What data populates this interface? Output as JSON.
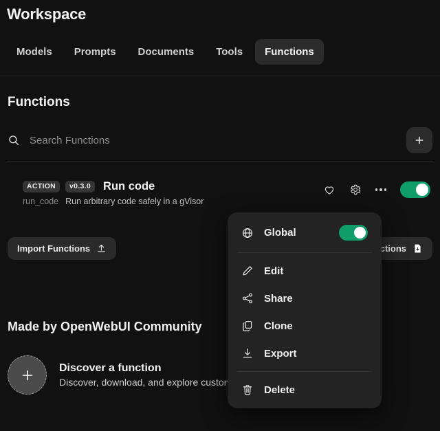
{
  "header": {
    "title": "Workspace",
    "tabs": [
      {
        "label": "Models",
        "active": false
      },
      {
        "label": "Prompts",
        "active": false
      },
      {
        "label": "Documents",
        "active": false
      },
      {
        "label": "Tools",
        "active": false
      },
      {
        "label": "Functions",
        "active": true
      }
    ]
  },
  "page": {
    "title": "Functions"
  },
  "search": {
    "placeholder": "Search Functions",
    "value": "",
    "icon": "search-icon",
    "add_icon": "plus-icon"
  },
  "function_item": {
    "type_badge": "ACTION",
    "version_badge": "v0.3.0",
    "name": "Run code",
    "id": "run_code",
    "description": "Run arbitrary code safely in a gVisor",
    "favorite_icon": "heart-icon",
    "settings_icon": "gear-icon",
    "more_icon": "ellipsis-icon",
    "enabled": true
  },
  "io_buttons": {
    "import_label": "Import Functions",
    "import_icon": "upload-icon",
    "export_label": "Export Functions",
    "export_icon": "document-download-icon"
  },
  "community": {
    "title": "Made by OpenWebUI Community",
    "discover_icon": "plus-icon",
    "discover_title": "Discover a function",
    "discover_subtitle": "Discover, download, and explore custom functions"
  },
  "context_menu": {
    "global": {
      "label": "Global",
      "icon": "globe-icon",
      "enabled": true
    },
    "items": [
      {
        "label": "Edit",
        "icon": "pencil-icon"
      },
      {
        "label": "Share",
        "icon": "share-icon"
      },
      {
        "label": "Clone",
        "icon": "copy-icon"
      },
      {
        "label": "Export",
        "icon": "download-icon"
      },
      {
        "label": "Delete",
        "icon": "trash-icon"
      }
    ]
  },
  "colors": {
    "background": "#111111",
    "surface": "#232323",
    "accent_green": "#0f9d6a",
    "text_primary": "#f2f2f2",
    "text_muted": "#8d8d8d"
  }
}
